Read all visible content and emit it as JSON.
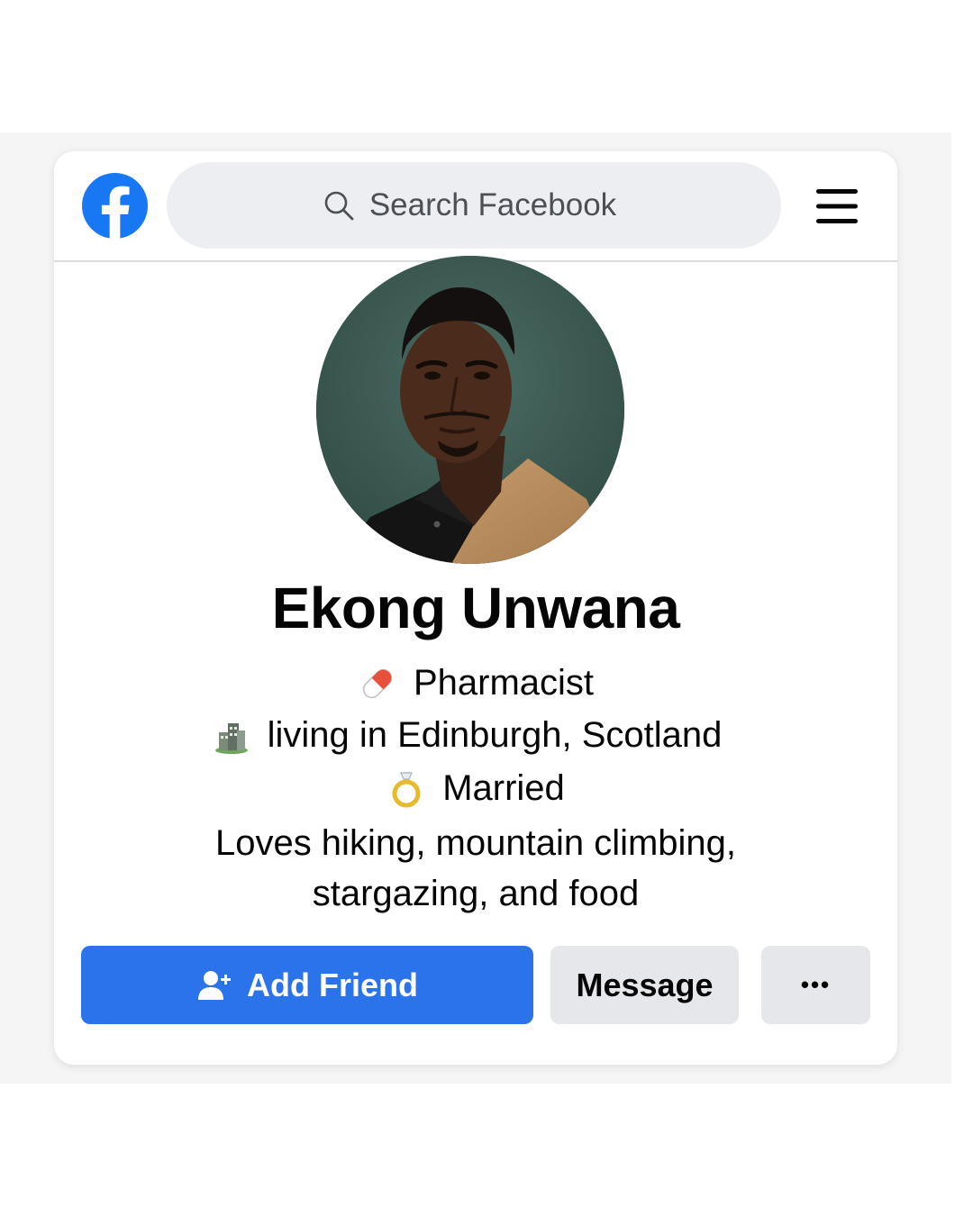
{
  "header": {
    "logo": "facebook-logo",
    "search_placeholder": "Search Facebook",
    "menu_icon": "hamburger-menu-icon"
  },
  "profile": {
    "name": "Ekong Unwana",
    "occupation": "Pharmacist",
    "location": "living in Edinburgh,  Scotland",
    "relationship": "Married",
    "bio_line1": "Loves hiking, mountain climbing,",
    "bio_line2": "stargazing, and food"
  },
  "actions": {
    "add_friend": "Add Friend",
    "message": "Message",
    "more": "•••"
  },
  "colors": {
    "brand_blue": "#1877F2",
    "button_blue": "#2A73EA",
    "button_gray": "#E5E7EB"
  }
}
